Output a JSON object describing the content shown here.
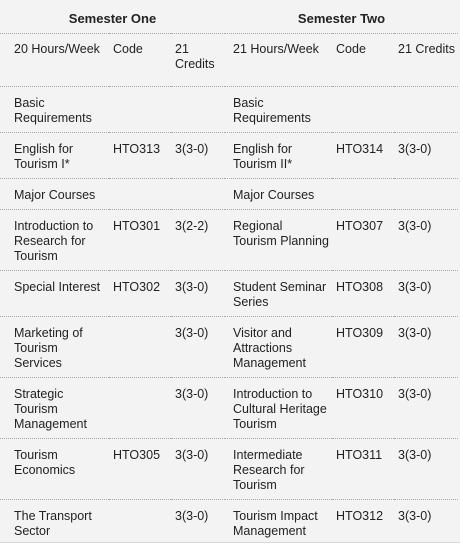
{
  "table": {
    "semester_one": "Semester One",
    "semester_two": "Semester Two",
    "subheader": {
      "hours_1": "20 Hours/Week",
      "code_1": "Code",
      "credits_1": "21 Credits",
      "hours_2": "21 Hours/Week",
      "code_2": "Code",
      "credits_2": "21 Credits"
    },
    "rows": [
      {
        "c1": "Basic Requirements",
        "c2": "",
        "c3": "",
        "c4": "Basic Requirements",
        "c5": "",
        "c6": ""
      },
      {
        "c1": "English for Tourism I*",
        "c2": "HTO313",
        "c3": "3(3-0)",
        "c4": "English for Tourism II*",
        "c5": "HTO314",
        "c6": "3(3-0)"
      },
      {
        "c1": "Major Courses",
        "c2": "",
        "c3": "",
        "c4": "Major Courses",
        "c5": "",
        "c6": ""
      },
      {
        "c1": "Introduction to Research for Tourism",
        "c2": "HTO301",
        "c3": "3(2-2)",
        "c4": "Regional Tourism Planning",
        "c5": "HTO307",
        "c6": "3(3-0)"
      },
      {
        "c1": "Special Interest",
        "c2": "HTO302",
        "c3": "3(3-0)",
        "c4": "Student Seminar Series",
        "c5": "HTO308",
        "c6": "3(3-0)"
      },
      {
        "c1": "Marketing of Tourism Services",
        "c2": "",
        "c3": "3(3-0)",
        "c4": "Visitor and Attractions Management",
        "c5": "HTO309",
        "c6": "3(3-0)"
      },
      {
        "c1": "Strategic Tourism Management",
        "c2": "",
        "c3": "3(3-0)",
        "c4": "Introduction to Cultural Heritage Tourism",
        "c5": "HTO310",
        "c6": "3(3-0)"
      },
      {
        "c1": "Tourism Economics",
        "c2": "HTO305",
        "c3": "3(3-0)",
        "c4": "Intermediate Research for Tourism",
        "c5": "HTO311",
        "c6": "3(3-0)"
      },
      {
        "c1": "The Transport Sector",
        "c2": "",
        "c3": "3(3-0)",
        "c4": "Tourism Impact Management",
        "c5": "HTO312",
        "c6": "3(3-0)"
      }
    ]
  }
}
